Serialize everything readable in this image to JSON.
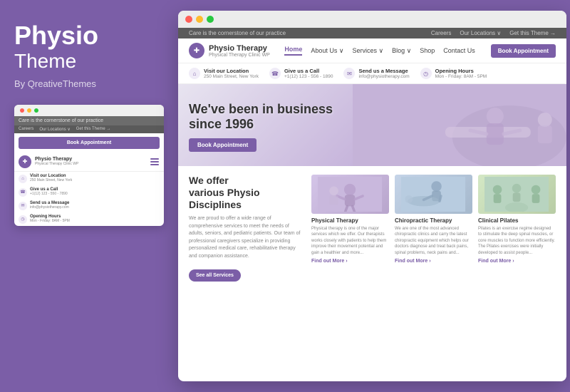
{
  "brand": {
    "name_bold": "Physio",
    "name_light": "Theme",
    "by": "By QreativeThemes"
  },
  "mini_browser": {
    "top_bar": "Care is the cornerstone of our practice",
    "nav_links": [
      "Careers",
      "Our Locations ∨",
      "Get this Theme →"
    ],
    "book_btn": "Book Appointment",
    "site_name": "Physio Therapy",
    "site_sub": "Physical Therapy Clinic WP",
    "info_rows": [
      {
        "icon": "📍",
        "label": "Visit our Location",
        "value": "250 Main Street, New York"
      },
      {
        "icon": "📞",
        "label": "Give us a Call",
        "value": "+1(12) 123 - 550 - 7890"
      },
      {
        "icon": "✉",
        "label": "Send us a Message",
        "value": "info@physiotherapy.com"
      },
      {
        "icon": "🕐",
        "label": "Opening Hours",
        "value": "Mon - Friday: 8AM - 5PM"
      }
    ]
  },
  "browser": {
    "site_top_bar": {
      "tagline": "Care is the cornerstone of our practice",
      "links": [
        "Careers",
        "Our Locations ∨",
        "Get this Theme →"
      ]
    },
    "nav": {
      "logo_name": "Physio Therapy",
      "logo_sub": "Physical Therapy Clinic WP",
      "links": [
        "Home",
        "About Us ∨",
        "Services ∨",
        "Blog ∨",
        "Shop",
        "Contact Us"
      ],
      "active_link": "Home",
      "book_btn": "Book Appointment"
    },
    "info_strip": [
      {
        "icon": "🏠",
        "label": "Visit our Location",
        "value": "250 Main Street, New York"
      },
      {
        "icon": "📞",
        "label": "Give us a Call",
        "value": "+1(12) 123 - 556 - 1890"
      },
      {
        "icon": "✉",
        "label": "Send us a Message",
        "value": "info@physiotherapy.com"
      },
      {
        "icon": "🕐",
        "label": "Opening Hours",
        "value": "Mon - Friday: 8AM - 5PM"
      }
    ],
    "hero": {
      "heading_line1": "We've been in business",
      "heading_line2": "since 1996",
      "btn_label": "Book Appointment"
    },
    "content": {
      "section_heading_line1": "We offer",
      "section_heading_line2": "various Physio",
      "section_heading_line3": "Disciplines",
      "section_text": "We are proud to offer a wide range of comprehensive services to meet the needs of adults, seniors, and pediatric patients. Our team of professional caregivers specialize in providing personalized medical care, rehabilitative therapy and companion assistance.",
      "see_services_btn": "See all Services"
    },
    "cards": [
      {
        "title": "Physical Therapy",
        "text": "Physical therapy is one of the major services which we offer. Our therapists works closely with patients to help them improve their movement potential and gain a healthier and more...",
        "link": "Find out More ›"
      },
      {
        "title": "Chiropractic Therapy",
        "text": "We are one of the most advanced chiropractic clinics and carry the latest chiropractic equipment which helps our doctors diagnose and treat back pains, spinal problems, neck pains and...",
        "link": "Find out More ›"
      },
      {
        "title": "Clinical Pilates",
        "text": "Pilates is an exercise regime designed to stimulate the deep spinal muscles, or core muscles to function more efficiently. The Pilates exercises were initially developed to assist people...",
        "link": "Find out More ›"
      }
    ]
  }
}
